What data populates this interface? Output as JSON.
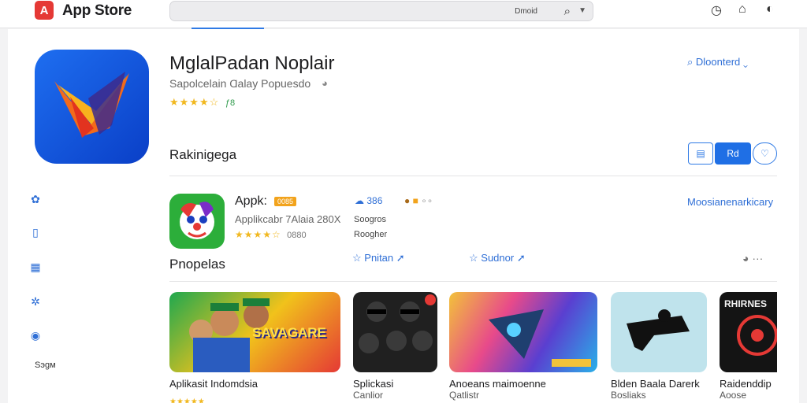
{
  "topbar": {
    "logo_letter": "A",
    "app_name": "App Store",
    "search_hint": "Dmoid",
    "icons": [
      "search-icon",
      "chevron-down-icon",
      "history-icon",
      "home-icon",
      "theme-toggle-icon"
    ]
  },
  "sidebar": {
    "items": [
      {
        "icon": "flower-icon"
      },
      {
        "icon": "clipboard-icon"
      },
      {
        "icon": "grid-icon"
      },
      {
        "icon": "settings-icon"
      },
      {
        "icon": "globe-icon"
      }
    ],
    "footer_label": "Ѕэɡм"
  },
  "hero": {
    "title": "MglalPadan Noplair",
    "subtitle": "Sapolcelain Ɑalay Popuesdo",
    "rating_value": "ƒ8",
    "download_label": "Dloonterd"
  },
  "rankings": {
    "title": "Rakinigega",
    "view_active_label": "Rd",
    "app": {
      "name": "Appk:",
      "badge": "0085",
      "subtitle": "Applikcabr 7Alaia 280X",
      "rating_value": "0880",
      "meta_count": "386",
      "meta_line1": "Soogros",
      "meta_line2": "Roogher",
      "action1": "Pnitan",
      "action2": "Sudnor",
      "more_link": "Moosianenarkicary"
    }
  },
  "popular": {
    "title": "Pnopelas",
    "cards": [
      {
        "title": "Aplikasit Indomdsia",
        "subtitle": "",
        "banner": "SAVAGARE"
      },
      {
        "title": "Splickasi",
        "subtitle": "Canlior",
        "banner": ""
      },
      {
        "title": "Anoeans maimoenne",
        "subtitle": "Qatlistr",
        "banner": ""
      },
      {
        "title": "Blden Baala Darerk",
        "subtitle": "Bosliaks",
        "banner": ""
      },
      {
        "title": "Raidenddip",
        "subtitle": "Aoose",
        "banner": "RHIRNES"
      }
    ]
  },
  "colors": {
    "accent": "#2f7ae5",
    "logo": "#e53935",
    "star": "#f1b820"
  }
}
